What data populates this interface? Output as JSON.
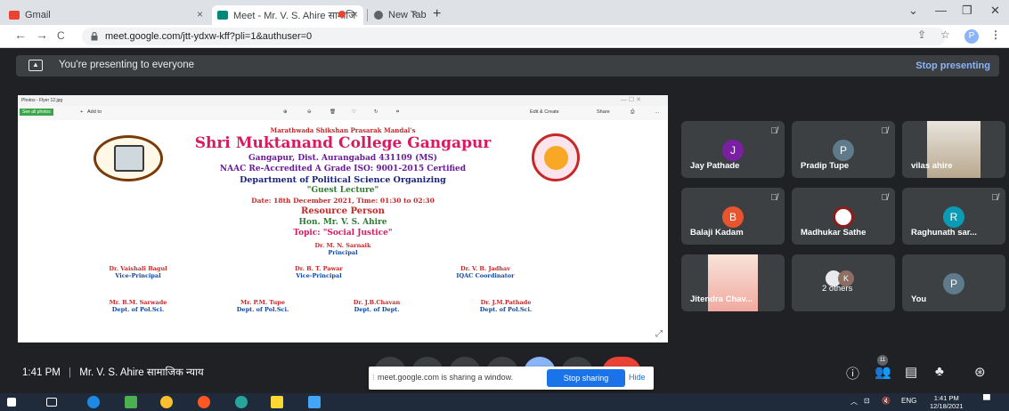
{
  "browser": {
    "tabs": [
      {
        "label": "Gmail",
        "active": false
      },
      {
        "label": "Meet - Mr. V. S. Ahire सामाजि",
        "active": true
      },
      {
        "label": "New Tab",
        "active": false
      }
    ],
    "address": "meet.google.com/jtt-ydxw-kff?pli=1&authuser=0",
    "profile_initial": "P"
  },
  "banner": {
    "text": "You're presenting to everyone",
    "stop_label": "Stop presenting"
  },
  "photos_window": {
    "title": "Photos - Flyer 12.jpg",
    "see_all": "See all photos",
    "add_to": "Add to",
    "edit_create": "Edit & Create",
    "share": "Share"
  },
  "flyer": {
    "society": "Marathwada Shikshan Prasarak Mandal's",
    "college": "Shri Muktanand College Gangapur",
    "address": "Gangapur, Dist. Aurangabad 431109 (MS)",
    "accreditation": "NAAC Re-Accredited A Grade ISO: 9001-2015 Certified",
    "department": "Department of Political Science Organizing",
    "event": "\"Guest Lecture\"",
    "datetime": "Date: 18th December 2021, Time: 01:30 to 02:30",
    "resource_heading": "Resource Person",
    "speaker": "Hon. Mr. V. S. Ahire",
    "topic": "Topic: \"Social Justice\"",
    "principal_name": "Dr. M. N. Sarnaik",
    "principal_role": "Principal",
    "row1": [
      {
        "name": "Dr. Vaishali Bagul",
        "role": "Vice-Principal"
      },
      {
        "name": "Dr. B. T. Pawar",
        "role": "Vice-Principal"
      },
      {
        "name": "Dr. V. B. Jadhav",
        "role": "IQAC Coordinator"
      }
    ],
    "row2": [
      {
        "name": "Mr. B.M. Sarwade",
        "role": "Dept. of Pol.Sci."
      },
      {
        "name": "Mr. P.M. Tupe",
        "role": "Dept. of Pol.Sci."
      },
      {
        "name": "Dr. J.B.Chavan",
        "role": "Dept. of Dept."
      },
      {
        "name": "Dr. J.M.Pathade",
        "role": "Dept. of Pol.Sci."
      }
    ]
  },
  "participants": [
    {
      "name": "Jay Pathade",
      "initial": "J",
      "color": "#7b1fa2",
      "type": "avatar"
    },
    {
      "name": "Pradip Tupe",
      "initial": "P",
      "color": "#5f7a8a",
      "type": "avatar"
    },
    {
      "name": "vilas ahire",
      "initial": "",
      "color": "",
      "type": "video"
    },
    {
      "name": "Balaji Kadam",
      "initial": "B",
      "color": "#e8542e",
      "type": "avatar"
    },
    {
      "name": "Madhukar Sathe",
      "initial": "",
      "color": "#ffffff",
      "type": "logo"
    },
    {
      "name": "Raghunath sar...",
      "initial": "R",
      "color": "#0b9bb5",
      "type": "avatar"
    },
    {
      "name": "Jitendra Chav...",
      "initial": "",
      "color": "",
      "type": "video"
    },
    {
      "name": "2 others",
      "initial": "K",
      "color": "#8d6e63",
      "type": "group"
    },
    {
      "name": "You",
      "initial": "P",
      "color": "#5f7a8a",
      "type": "avatar"
    }
  ],
  "bottombar": {
    "time": "1:41 PM",
    "separator": "|",
    "meeting": "Mr. V. S. Ahire सामाजिक न्याय",
    "people_count": "11"
  },
  "share_popup": {
    "message": "meet.google.com is sharing a window.",
    "stop_label": "Stop sharing",
    "hide_label": "Hide"
  },
  "taskbar": {
    "lang": "ENG",
    "time": "1:41 PM",
    "date": "12/18/2021"
  }
}
